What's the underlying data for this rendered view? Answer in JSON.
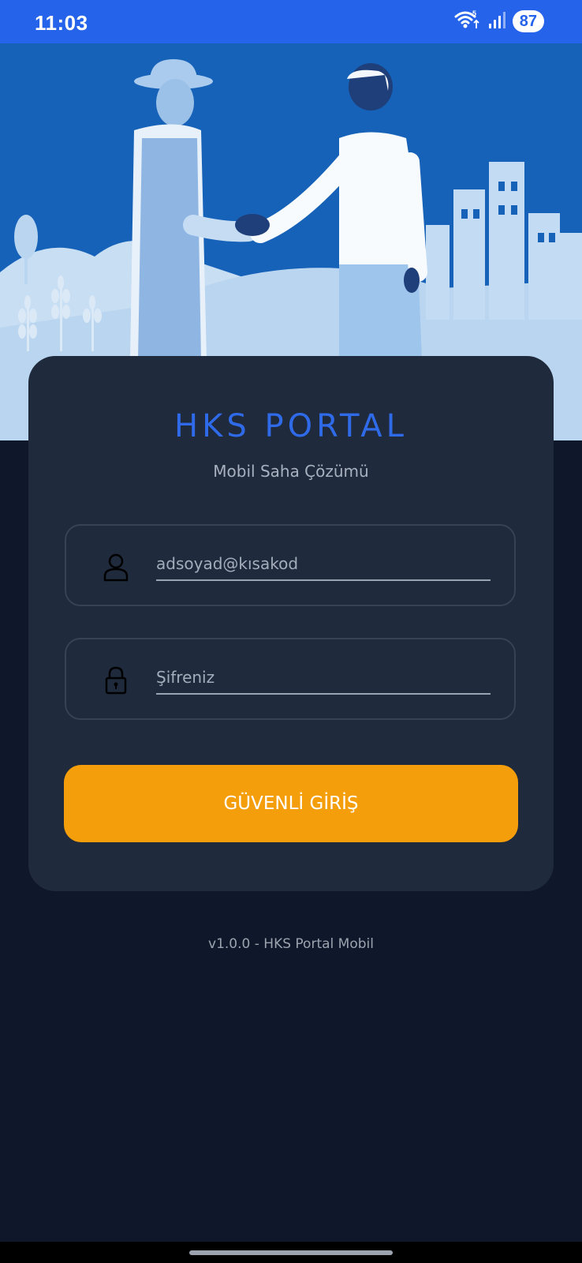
{
  "status_bar": {
    "time": "11:03",
    "battery": "87",
    "icons": [
      "wifi-icon",
      "signal-icon",
      "battery-icon"
    ],
    "background": "#2563eb"
  },
  "hero": {
    "illustration": "handshake-farmer-businessman-illustration",
    "background": "#1662b8"
  },
  "login": {
    "title": "HKS PORTAL",
    "subtitle": "Mobil Saha Çözümü",
    "username_placeholder": "adsoyad@kısakod",
    "password_placeholder": "Şifreniz",
    "username_icon": "user-icon",
    "password_icon": "lock-icon",
    "submit_label": "GÜVENLİ GİRİŞ",
    "accent": "#2f6ae8",
    "button_color": "#f59e0b"
  },
  "footer": {
    "version": "v1.0.0 - HKS Portal Mobil"
  }
}
